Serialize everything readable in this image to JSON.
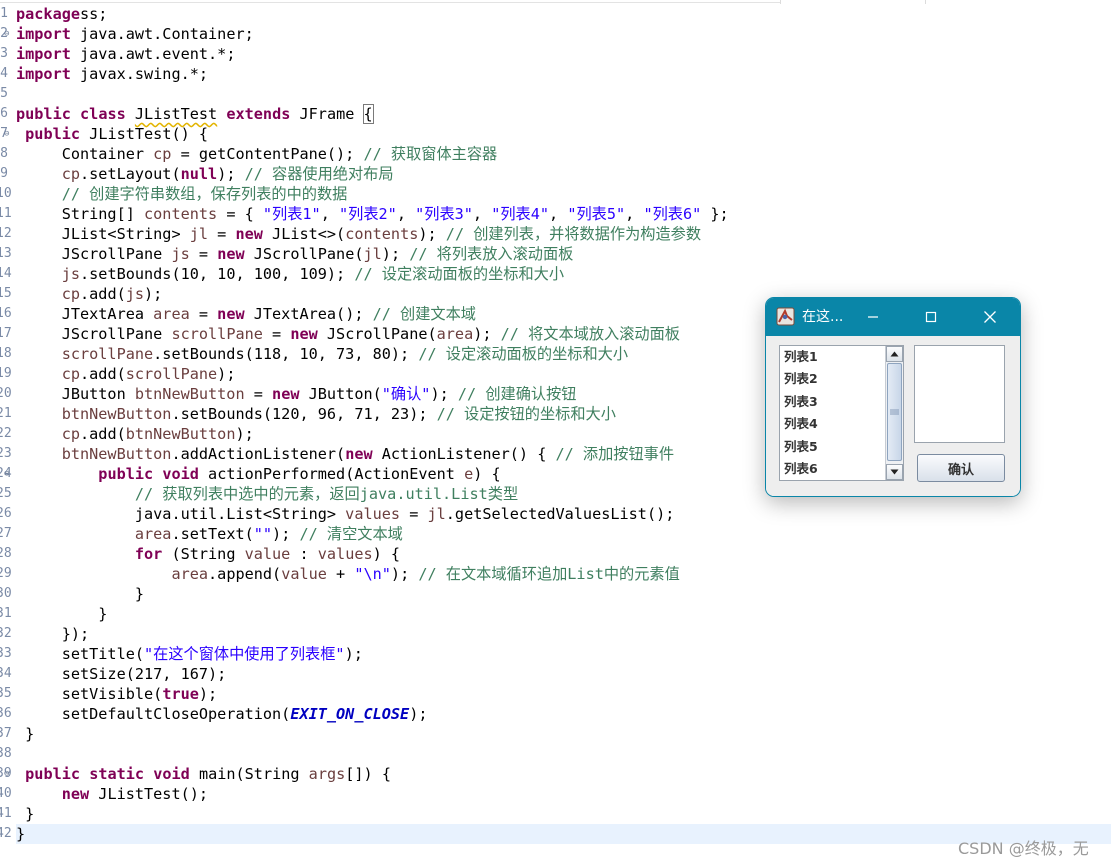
{
  "editor": {
    "line_numbers": [
      "1",
      "2",
      "3",
      "4",
      "5",
      "6",
      "7",
      "8",
      "9",
      "10",
      "11",
      "12",
      "13",
      "14",
      "15",
      "16",
      "17",
      "18",
      "19",
      "20",
      "21",
      "22",
      "23",
      "24",
      "25",
      "26",
      "27",
      "28",
      "29",
      "30",
      "31",
      "32",
      "33",
      "34",
      "35",
      "36",
      "37",
      "38",
      "39",
      "40",
      "41",
      "42"
    ],
    "fold_marker": "⊖",
    "lines": [
      [
        [
          "kw",
          "package"
        ],
        [
          "",
          "ss;"
        ]
      ],
      [
        [
          "kw",
          "import"
        ],
        [
          "",
          " java.awt.Container;"
        ]
      ],
      [
        [
          "kw",
          "import"
        ],
        [
          "",
          " java.awt.event.*;"
        ]
      ],
      [
        [
          "kw",
          "import"
        ],
        [
          "",
          " javax.swing.*;"
        ]
      ],
      [],
      [
        [
          "kw",
          "public"
        ],
        [
          "",
          " "
        ],
        [
          "kw",
          "class"
        ],
        [
          "",
          " "
        ],
        [
          "warn",
          "JListTest"
        ],
        [
          "",
          " "
        ],
        [
          "kw",
          "extends"
        ],
        [
          "",
          " JFrame "
        ],
        [
          "brk",
          "{"
        ]
      ],
      [
        [
          "",
          " "
        ],
        [
          "kw",
          "public"
        ],
        [
          "",
          " JListTest() {"
        ]
      ],
      [
        [
          "",
          "     Container "
        ],
        [
          "var",
          "cp"
        ],
        [
          "",
          " = getContentPane(); "
        ],
        [
          "cmt",
          "// 获取窗体主容器"
        ]
      ],
      [
        [
          "",
          "     "
        ],
        [
          "var",
          "cp"
        ],
        [
          "",
          ".setLayout("
        ],
        [
          "kw",
          "null"
        ],
        [
          "",
          "); "
        ],
        [
          "cmt",
          "// 容器使用绝对布局"
        ]
      ],
      [
        [
          "",
          "     "
        ],
        [
          "cmt",
          "// 创建字符串数组，保存列表的中的数据"
        ]
      ],
      [
        [
          "",
          "     String[] "
        ],
        [
          "var",
          "contents"
        ],
        [
          "",
          " = { "
        ],
        [
          "str",
          "\"列表1\""
        ],
        [
          "",
          ", "
        ],
        [
          "str",
          "\"列表2\""
        ],
        [
          "",
          ", "
        ],
        [
          "str",
          "\"列表3\""
        ],
        [
          "",
          ", "
        ],
        [
          "str",
          "\"列表4\""
        ],
        [
          "",
          ", "
        ],
        [
          "str",
          "\"列表5\""
        ],
        [
          "",
          ", "
        ],
        [
          "str",
          "\"列表6\""
        ],
        [
          "",
          " };"
        ]
      ],
      [
        [
          "",
          "     JList<String> "
        ],
        [
          "var",
          "jl"
        ],
        [
          "",
          " = "
        ],
        [
          "kw",
          "new"
        ],
        [
          "",
          " JList<>("
        ],
        [
          "var",
          "contents"
        ],
        [
          "",
          "); "
        ],
        [
          "cmt",
          "// 创建列表，并将数据作为构造参数"
        ]
      ],
      [
        [
          "",
          "     JScrollPane "
        ],
        [
          "var",
          "js"
        ],
        [
          "",
          " = "
        ],
        [
          "kw",
          "new"
        ],
        [
          "",
          " JScrollPane("
        ],
        [
          "var",
          "jl"
        ],
        [
          "",
          "); "
        ],
        [
          "cmt",
          "// 将列表放入滚动面板"
        ]
      ],
      [
        [
          "",
          "     "
        ],
        [
          "var",
          "js"
        ],
        [
          "",
          ".setBounds(10, 10, 100, 109); "
        ],
        [
          "cmt",
          "// 设定滚动面板的坐标和大小"
        ]
      ],
      [
        [
          "",
          "     "
        ],
        [
          "var",
          "cp"
        ],
        [
          "",
          ".add("
        ],
        [
          "var",
          "js"
        ],
        [
          "",
          ");"
        ]
      ],
      [
        [
          "",
          "     JTextArea "
        ],
        [
          "var",
          "area"
        ],
        [
          "",
          " = "
        ],
        [
          "kw",
          "new"
        ],
        [
          "",
          " JTextArea(); "
        ],
        [
          "cmt",
          "// 创建文本域"
        ]
      ],
      [
        [
          "",
          "     JScrollPane "
        ],
        [
          "var",
          "scrollPane"
        ],
        [
          "",
          " = "
        ],
        [
          "kw",
          "new"
        ],
        [
          "",
          " JScrollPane("
        ],
        [
          "var",
          "area"
        ],
        [
          "",
          "); "
        ],
        [
          "cmt",
          "// 将文本域放入滚动面板"
        ]
      ],
      [
        [
          "",
          "     "
        ],
        [
          "var",
          "scrollPane"
        ],
        [
          "",
          ".setBounds(118, 10, 73, 80); "
        ],
        [
          "cmt",
          "// 设定滚动面板的坐标和大小"
        ]
      ],
      [
        [
          "",
          "     "
        ],
        [
          "var",
          "cp"
        ],
        [
          "",
          ".add("
        ],
        [
          "var",
          "scrollPane"
        ],
        [
          "",
          ");"
        ]
      ],
      [
        [
          "",
          "     JButton "
        ],
        [
          "var",
          "btnNewButton"
        ],
        [
          "",
          " = "
        ],
        [
          "kw",
          "new"
        ],
        [
          "",
          " JButton("
        ],
        [
          "str",
          "\"确认\""
        ],
        [
          "",
          "); "
        ],
        [
          "cmt",
          "// 创建确认按钮"
        ]
      ],
      [
        [
          "",
          "     "
        ],
        [
          "var",
          "btnNewButton"
        ],
        [
          "",
          ".setBounds(120, 96, 71, 23); "
        ],
        [
          "cmt",
          "// 设定按钮的坐标和大小"
        ]
      ],
      [
        [
          "",
          "     "
        ],
        [
          "var",
          "cp"
        ],
        [
          "",
          ".add("
        ],
        [
          "var",
          "btnNewButton"
        ],
        [
          "",
          ");"
        ]
      ],
      [
        [
          "",
          "     "
        ],
        [
          "var",
          "btnNewButton"
        ],
        [
          "",
          ".addActionListener("
        ],
        [
          "kw",
          "new"
        ],
        [
          "",
          " ActionListener() { "
        ],
        [
          "cmt",
          "// 添加按钮事件"
        ]
      ],
      [
        [
          "",
          "         "
        ],
        [
          "kw",
          "public"
        ],
        [
          "",
          " "
        ],
        [
          "kw",
          "void"
        ],
        [
          "",
          " actionPerformed(ActionEvent "
        ],
        [
          "var",
          "e"
        ],
        [
          "",
          ") {"
        ]
      ],
      [
        [
          "",
          "             "
        ],
        [
          "cmt",
          "// 获取列表中选中的元素，返回java.util.List类型"
        ]
      ],
      [
        [
          "",
          "             java.util.List<String> "
        ],
        [
          "var",
          "values"
        ],
        [
          "",
          " = "
        ],
        [
          "var",
          "jl"
        ],
        [
          "",
          ".getSelectedValuesList();"
        ]
      ],
      [
        [
          "",
          "             "
        ],
        [
          "var",
          "area"
        ],
        [
          "",
          ".setText("
        ],
        [
          "str",
          "\"\""
        ],
        [
          "",
          "); "
        ],
        [
          "cmt",
          "// 清空文本域"
        ]
      ],
      [
        [
          "",
          "             "
        ],
        [
          "kw",
          "for"
        ],
        [
          "",
          " (String "
        ],
        [
          "var",
          "value"
        ],
        [
          "",
          " : "
        ],
        [
          "var",
          "values"
        ],
        [
          "",
          ") {"
        ]
      ],
      [
        [
          "",
          "                 "
        ],
        [
          "var",
          "area"
        ],
        [
          "",
          ".append("
        ],
        [
          "var",
          "value"
        ],
        [
          "",
          " + "
        ],
        [
          "str",
          "\"\\n\""
        ],
        [
          "",
          "); "
        ],
        [
          "cmt",
          "// 在文本域循环追加List中的元素值"
        ]
      ],
      [
        [
          "",
          "             }"
        ]
      ],
      [
        [
          "",
          "         }"
        ]
      ],
      [
        [
          "",
          "     });"
        ]
      ],
      [
        [
          "",
          "     setTitle("
        ],
        [
          "str",
          "\"在这个窗体中使用了列表框\""
        ],
        [
          "",
          ");"
        ]
      ],
      [
        [
          "",
          "     setSize(217, 167);"
        ]
      ],
      [
        [
          "",
          "     setVisible("
        ],
        [
          "kw",
          "true"
        ],
        [
          "",
          ");"
        ]
      ],
      [
        [
          "",
          "     setDefaultCloseOperation("
        ],
        [
          "const",
          "EXIT_ON_CLOSE"
        ],
        [
          "",
          ");"
        ]
      ],
      [
        [
          "",
          " }"
        ]
      ],
      [],
      [
        [
          "",
          " "
        ],
        [
          "kw",
          "public"
        ],
        [
          "",
          " "
        ],
        [
          "kw",
          "static"
        ],
        [
          "",
          " "
        ],
        [
          "kw",
          "void"
        ],
        [
          "",
          " main(String "
        ],
        [
          "var",
          "args"
        ],
        [
          "",
          "[]) {"
        ]
      ],
      [
        [
          "",
          "     "
        ],
        [
          "kw",
          "new"
        ],
        [
          "",
          " JListTest();"
        ]
      ],
      [
        [
          "",
          " }"
        ]
      ],
      [
        [
          "",
          "}"
        ]
      ]
    ]
  },
  "window": {
    "title": "在这...",
    "list_items": [
      "列表1",
      "列表2",
      "列表3",
      "列表4",
      "列表5",
      "列表6"
    ],
    "confirm_label": "确认"
  },
  "watermark": "CSDN @终极，无",
  "colors": {
    "keyword": "#7f0055",
    "string": "#2a00ff",
    "comment": "#3f7f5f",
    "titlebar": "#0a86a8"
  }
}
